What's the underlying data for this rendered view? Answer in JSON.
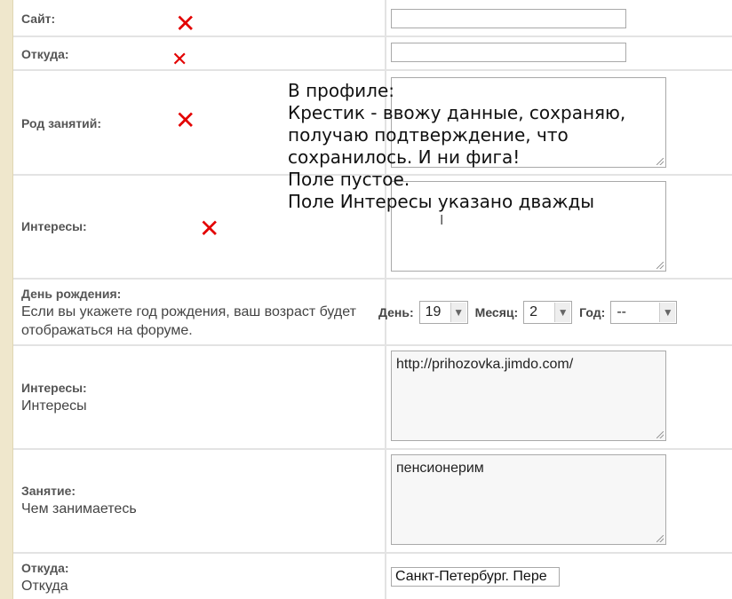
{
  "form": {
    "site": {
      "label": "Сайт:"
    },
    "from_top": {
      "label": "Откуда:"
    },
    "occupation_top": {
      "label": "Род занятий:"
    },
    "interests_top": {
      "label": "Интересы:"
    },
    "birthday": {
      "label": "День рождения:",
      "description": "Если вы укажете год рождения, ваш возраст будет отображаться на форуме.",
      "day_label": "День:",
      "day_value": "19",
      "month_label": "Месяц:",
      "month_value": "2",
      "year_label": "Год:",
      "year_value": "--"
    },
    "interests": {
      "label": "Интересы:",
      "description": "Интересы",
      "value": "http://prihozovka.jimdo.com/"
    },
    "occupation": {
      "label": "Занятие:",
      "description": "Чем занимаетесь",
      "value": "пенсионерим"
    },
    "from": {
      "label": "Откуда:",
      "description": "Откуда",
      "value": "Санкт-Петербург. Пере"
    }
  },
  "annotation": {
    "note_text": "В профиле:\nКрестик - ввожу данные, сохраняю,\nполучаю подтверждение, что\nсохранилось. И ни фига!\nПоле пустое.\nПоле Интересы указано дважды",
    "cross_mark": "✕",
    "cursor_glyph": "I",
    "cross_color": "#e30000"
  },
  "colors": {
    "sidebar": "#efe7cc",
    "divider": "#e3e3e3"
  }
}
